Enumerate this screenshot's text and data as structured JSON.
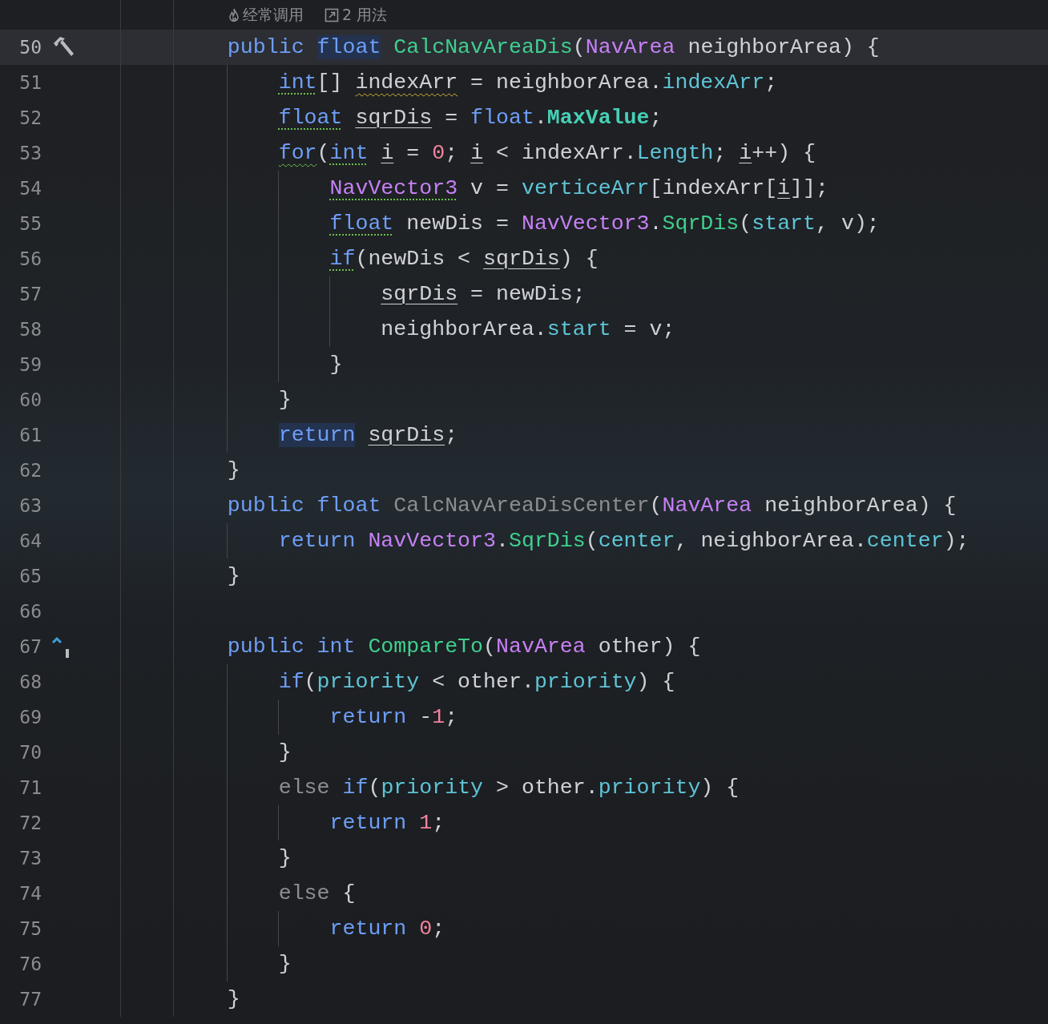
{
  "hints": [
    {
      "kind": "fire",
      "label": "经常调用"
    },
    {
      "kind": "link",
      "label": "2 用法"
    }
  ],
  "lines": [
    {
      "number": "50",
      "gutter": {
        "kind": "hammer"
      },
      "current": true,
      "tokens": [
        {
          "text": "    public ",
          "kind": "kw"
        },
        {
          "text": "float",
          "kind": "kw",
          "highlighted": true
        },
        {
          "text": " CalcNavAreaDis",
          "kind": "fn"
        },
        {
          "text": "(",
          "kind": "plain"
        },
        {
          "text": "NavArea",
          "kind": "type"
        },
        {
          "text": " neighborArea) {",
          "kind": "plain"
        }
      ]
    },
    {
      "number": "51",
      "current": false,
      "tokens": [
        {
          "text": "        int",
          "kind": "kw",
          "dotted": true
        },
        {
          "text": "[] ",
          "kind": "plain"
        },
        {
          "text": "indexArr",
          "kind": "plain",
          "wavy": true
        },
        {
          "text": " = neighborArea.",
          "kind": "plain"
        },
        {
          "text": "indexArr",
          "kind": "field"
        },
        {
          "text": ";",
          "kind": "plain"
        }
      ]
    },
    {
      "number": "52",
      "current": false,
      "tokens": [
        {
          "text": "        float",
          "kind": "kw",
          "dotted": true
        },
        {
          "text": " sqrDis",
          "kind": "plain",
          "ref": true
        },
        {
          "text": " = ",
          "kind": "plain"
        },
        {
          "text": "float",
          "kind": "kw"
        },
        {
          "text": ".",
          "kind": "plain"
        },
        {
          "text": "MaxValue",
          "kind": "const"
        },
        {
          "text": ";",
          "kind": "plain"
        }
      ]
    },
    {
      "number": "53",
      "current": false,
      "tokens": [
        {
          "text": "        for",
          "kind": "kw",
          "green_wavy": true
        },
        {
          "text": "(",
          "kind": "plain"
        },
        {
          "text": "int",
          "kind": "kw",
          "dotted": true
        },
        {
          "text": " i",
          "kind": "plain",
          "ref": true
        },
        {
          "text": " = ",
          "kind": "plain"
        },
        {
          "text": "0",
          "kind": "num"
        },
        {
          "text": "; ",
          "kind": "plain"
        },
        {
          "text": "i",
          "kind": "plain",
          "ref": true
        },
        {
          "text": " < indexArr.",
          "kind": "plain"
        },
        {
          "text": "Length",
          "kind": "field"
        },
        {
          "text": "; ",
          "kind": "plain"
        },
        {
          "text": "i",
          "kind": "plain",
          "ref": true
        },
        {
          "text": "++) {",
          "kind": "plain"
        }
      ]
    },
    {
      "number": "54",
      "current": false,
      "tokens": [
        {
          "text": "            NavVector3",
          "kind": "type",
          "dotted": true
        },
        {
          "text": " v = ",
          "kind": "plain"
        },
        {
          "text": "verticeArr",
          "kind": "field"
        },
        {
          "text": "[indexArr[",
          "kind": "plain"
        },
        {
          "text": "i",
          "kind": "plain",
          "ref": true
        },
        {
          "text": "]];",
          "kind": "plain"
        }
      ]
    },
    {
      "number": "55",
      "current": false,
      "tokens": [
        {
          "text": "            float",
          "kind": "kw",
          "dotted": true
        },
        {
          "text": " newDis = ",
          "kind": "plain"
        },
        {
          "text": "NavVector3",
          "kind": "type"
        },
        {
          "text": ".",
          "kind": "plain"
        },
        {
          "text": "SqrDis",
          "kind": "fn"
        },
        {
          "text": "(",
          "kind": "plain"
        },
        {
          "text": "start",
          "kind": "field"
        },
        {
          "text": ", v);",
          "kind": "plain"
        }
      ]
    },
    {
      "number": "56",
      "current": false,
      "tokens": [
        {
          "text": "            if",
          "kind": "kw",
          "dotted": true
        },
        {
          "text": "(newDis < ",
          "kind": "plain"
        },
        {
          "text": "sqrDis",
          "kind": "plain",
          "ref": true
        },
        {
          "text": ") {",
          "kind": "plain"
        }
      ]
    },
    {
      "number": "57",
      "current": false,
      "tokens": [
        {
          "text": "                sqrDis",
          "kind": "plain",
          "ref": true
        },
        {
          "text": " = newDis;",
          "kind": "plain"
        }
      ]
    },
    {
      "number": "58",
      "current": false,
      "tokens": [
        {
          "text": "                neighborArea.",
          "kind": "plain"
        },
        {
          "text": "start",
          "kind": "field"
        },
        {
          "text": " = v;",
          "kind": "plain"
        }
      ]
    },
    {
      "number": "59",
      "current": false,
      "tokens": [
        {
          "text": "            }",
          "kind": "plain"
        }
      ]
    },
    {
      "number": "60",
      "current": false,
      "tokens": [
        {
          "text": "        }",
          "kind": "plain"
        }
      ]
    },
    {
      "number": "61",
      "current": false,
      "tokens": [
        {
          "text": "        return",
          "kind": "kw",
          "highlighted": true
        },
        {
          "text": " sqrDis",
          "kind": "plain",
          "ref": true
        },
        {
          "text": ";",
          "kind": "plain"
        }
      ]
    },
    {
      "number": "62",
      "current": false,
      "tokens": [
        {
          "text": "    }",
          "kind": "plain"
        }
      ]
    },
    {
      "number": "63",
      "current": false,
      "tokens": [
        {
          "text": "    public float",
          "kind": "kw"
        },
        {
          "text": " CalcNavAreaDisCenter",
          "kind": "muted"
        },
        {
          "text": "(",
          "kind": "plain"
        },
        {
          "text": "NavArea",
          "kind": "type"
        },
        {
          "text": " neighborArea) {",
          "kind": "plain"
        }
      ]
    },
    {
      "number": "64",
      "current": false,
      "tokens": [
        {
          "text": "        return",
          "kind": "kw"
        },
        {
          "text": " NavVector3",
          "kind": "type"
        },
        {
          "text": ".",
          "kind": "plain"
        },
        {
          "text": "SqrDis",
          "kind": "fn"
        },
        {
          "text": "(",
          "kind": "plain"
        },
        {
          "text": "center",
          "kind": "field"
        },
        {
          "text": ", neighborArea.",
          "kind": "plain"
        },
        {
          "text": "center",
          "kind": "field"
        },
        {
          "text": ");",
          "kind": "plain"
        }
      ]
    },
    {
      "number": "65",
      "current": false,
      "tokens": [
        {
          "text": "    }",
          "kind": "plain"
        }
      ]
    },
    {
      "number": "66",
      "current": false
    },
    {
      "number": "67",
      "gutter": {
        "kind": "implements"
      },
      "current": false,
      "tokens": [
        {
          "text": "    public int",
          "kind": "kw"
        },
        {
          "text": " CompareTo",
          "kind": "fn"
        },
        {
          "text": "(",
          "kind": "plain"
        },
        {
          "text": "NavArea",
          "kind": "type"
        },
        {
          "text": " other) {",
          "kind": "plain"
        }
      ]
    },
    {
      "number": "68",
      "current": false,
      "tokens": [
        {
          "text": "        if",
          "kind": "kw"
        },
        {
          "text": "(",
          "kind": "plain"
        },
        {
          "text": "priority",
          "kind": "field"
        },
        {
          "text": " < other.",
          "kind": "plain"
        },
        {
          "text": "priority",
          "kind": "field"
        },
        {
          "text": ") {",
          "kind": "plain"
        }
      ]
    },
    {
      "number": "69",
      "current": false,
      "tokens": [
        {
          "text": "            return",
          "kind": "kw"
        },
        {
          "text": " -",
          "kind": "plain"
        },
        {
          "text": "1",
          "kind": "num"
        },
        {
          "text": ";",
          "kind": "plain"
        }
      ]
    },
    {
      "number": "70",
      "current": false,
      "tokens": [
        {
          "text": "        }",
          "kind": "plain"
        }
      ]
    },
    {
      "number": "71",
      "current": false,
      "tokens": [
        {
          "text": "        else",
          "kind": "muted"
        },
        {
          "text": " if",
          "kind": "kw"
        },
        {
          "text": "(",
          "kind": "plain"
        },
        {
          "text": "priority",
          "kind": "field"
        },
        {
          "text": " > other.",
          "kind": "plain"
        },
        {
          "text": "priority",
          "kind": "field"
        },
        {
          "text": ") {",
          "kind": "plain"
        }
      ]
    },
    {
      "number": "72",
      "current": false,
      "tokens": [
        {
          "text": "            return",
          "kind": "kw"
        },
        {
          "text": " 1",
          "kind": "num"
        },
        {
          "text": ";",
          "kind": "plain"
        }
      ]
    },
    {
      "number": "73",
      "current": false,
      "tokens": [
        {
          "text": "        }",
          "kind": "plain"
        }
      ]
    },
    {
      "number": "74",
      "current": false,
      "tokens": [
        {
          "text": "        else",
          "kind": "muted"
        },
        {
          "text": " {",
          "kind": "plain"
        }
      ]
    },
    {
      "number": "75",
      "current": false,
      "tokens": [
        {
          "text": "            return",
          "kind": "kw"
        },
        {
          "text": " 0",
          "kind": "num"
        },
        {
          "text": ";",
          "kind": "plain"
        }
      ]
    },
    {
      "number": "76",
      "current": false,
      "tokens": [
        {
          "text": "        }",
          "kind": "plain"
        }
      ]
    },
    {
      "number": "77",
      "current": false,
      "tokens": [
        {
          "text": "    }",
          "kind": "plain"
        }
      ]
    }
  ]
}
